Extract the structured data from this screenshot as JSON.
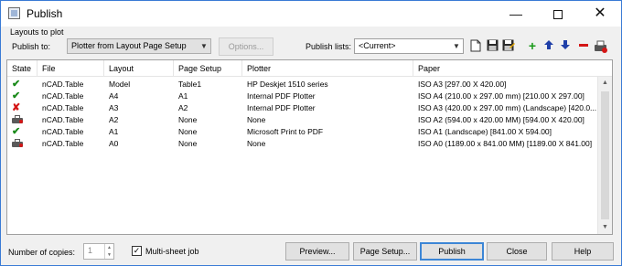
{
  "window": {
    "title": "Publish",
    "icon": "publish-app-icon"
  },
  "section_label": "Layouts to plot",
  "publish_to": {
    "label": "Publish to:",
    "value": "Plotter from Layout Page Setup",
    "options_button": "Options..."
  },
  "publish_lists": {
    "label": "Publish lists:",
    "value": "<Current>"
  },
  "toolbar_icons": [
    "new-list-icon",
    "save-list-icon",
    "save-as-list-icon",
    "add-icon",
    "move-up-icon",
    "move-down-icon",
    "remove-icon",
    "plot-stamp-icon"
  ],
  "table": {
    "columns": [
      "State",
      "File",
      "Layout",
      "Page Setup",
      "Plotter",
      "Paper"
    ],
    "rows": [
      {
        "state": "ok",
        "file": "nCAD.Table",
        "layout": "Model",
        "page_setup": "Table1",
        "plotter": "HP Deskjet 1510 series",
        "paper": "ISO A3 [297.00 X 420.00]"
      },
      {
        "state": "ok",
        "file": "nCAD.Table",
        "layout": "A4",
        "page_setup": "A1",
        "plotter": "Internal PDF Plotter",
        "paper": "ISO A4 (210.00 x 297.00 mm) [210.00 X 297.00]"
      },
      {
        "state": "error",
        "file": "nCAD.Table",
        "layout": "A3",
        "page_setup": "A2",
        "plotter": "Internal PDF Plotter",
        "paper": "ISO A3 (420.00 x 297.00 mm) (Landscape) [420.0..."
      },
      {
        "state": "printer",
        "file": "nCAD.Table",
        "layout": "A2",
        "page_setup": "None",
        "plotter": "None",
        "paper": "ISO A2 (594.00 x 420.00 MM) [594.00 X 420.00]"
      },
      {
        "state": "ok",
        "file": "nCAD.Table",
        "layout": "A1",
        "page_setup": "None",
        "plotter": "Microsoft Print to PDF",
        "paper": "ISO A1 (Landscape) [841.00 X 594.00]"
      },
      {
        "state": "printer",
        "file": "nCAD.Table",
        "layout": "A0",
        "page_setup": "None",
        "plotter": "None",
        "paper": "ISO A0 (1189.00 x 841.00 MM) [1189.00 X 841.00]"
      }
    ]
  },
  "footer": {
    "copies_label": "Number of copies:",
    "copies_value": "1",
    "multisheet_label": "Multi-sheet job",
    "multisheet_checked": true,
    "buttons": {
      "preview": "Preview...",
      "page_setup": "Page Setup...",
      "publish": "Publish",
      "close": "Close",
      "help": "Help"
    }
  },
  "colors": {
    "accent": "#3c86d6",
    "ok": "#1a8a1a",
    "error": "#d41616"
  }
}
